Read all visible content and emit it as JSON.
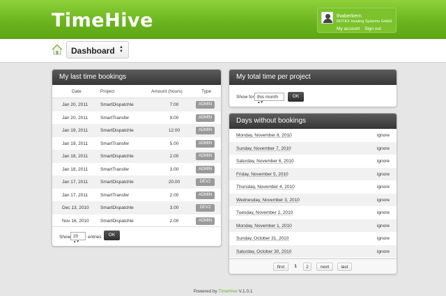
{
  "header": {
    "logo": "TimeHive",
    "user": {
      "name": "thaberkern",
      "company": "ROTEX Heating Systems GmbH",
      "my_account": "My account",
      "sign_out": "Sign out"
    }
  },
  "subheader": {
    "dashboard_label": "Dashboard"
  },
  "bookings": {
    "title": "My last time bookings",
    "columns": [
      "Date",
      "Project",
      "Amount (hours)",
      "Type"
    ],
    "rows": [
      {
        "date": "Jan 20, 2011",
        "project": "SmartDispatchle",
        "amount": "7.00",
        "type": "ADMIN"
      },
      {
        "date": "Jan 20, 2011",
        "project": "SmartTransfer",
        "amount": "9.00",
        "type": "ADMIN"
      },
      {
        "date": "Jan 19, 2011",
        "project": "SmartDispatchle",
        "amount": "12.00",
        "type": "ADMIN"
      },
      {
        "date": "Jan 19, 2011",
        "project": "SmartTransfer",
        "amount": "5.00",
        "type": "ADMIN"
      },
      {
        "date": "Jan 18, 2011",
        "project": "SmartDispatchle",
        "amount": "2.00",
        "type": "ADMIN"
      },
      {
        "date": "Jan 18, 2011",
        "project": "SmartTransfer",
        "amount": "3.00",
        "type": "ADMIN"
      },
      {
        "date": "Jan 17, 2011",
        "project": "SmartDispatchle",
        "amount": "20.00",
        "type": "DEV2"
      },
      {
        "date": "Jan 17, 2011",
        "project": "SmartTransfer",
        "amount": "2.00",
        "type": "ADMIN"
      },
      {
        "date": "Dec 13, 2010",
        "project": "SmartDispatchle",
        "amount": "3.00",
        "type": "DEV2"
      },
      {
        "date": "Nov 16, 2010",
        "project": "SmartDispatchle",
        "amount": "2.00",
        "type": "ADMIN"
      }
    ],
    "footer": {
      "show_label": "Show",
      "entries_value": "20",
      "entries_label": "entries",
      "ok_label": "OK"
    }
  },
  "total_time": {
    "title": "My total time per project",
    "show_for_label": "Show for",
    "period_value": "this month",
    "ok_label": "OK"
  },
  "days_without": {
    "title": "Days without bookings",
    "ignore_label": "ignore",
    "days": [
      "Monday, November 8, 2010",
      "Sunday, November 7, 2010",
      "Saturday, November 6, 2010",
      "Friday, November 5, 2010",
      "Thursday, November 4, 2010",
      "Wednesday, November 3, 2010",
      "Tuesday, November 2, 2010",
      "Monday, November 1, 2010",
      "Sunday, October 31, 2010",
      "Saturday, October 30, 2010"
    ],
    "pagination": {
      "first": "first",
      "page1": "1",
      "page2": "2",
      "next": "next",
      "last": "last"
    }
  },
  "footer": {
    "powered_by": "Powered by",
    "brand": "TimeHive",
    "version": "V.1.0.1"
  }
}
